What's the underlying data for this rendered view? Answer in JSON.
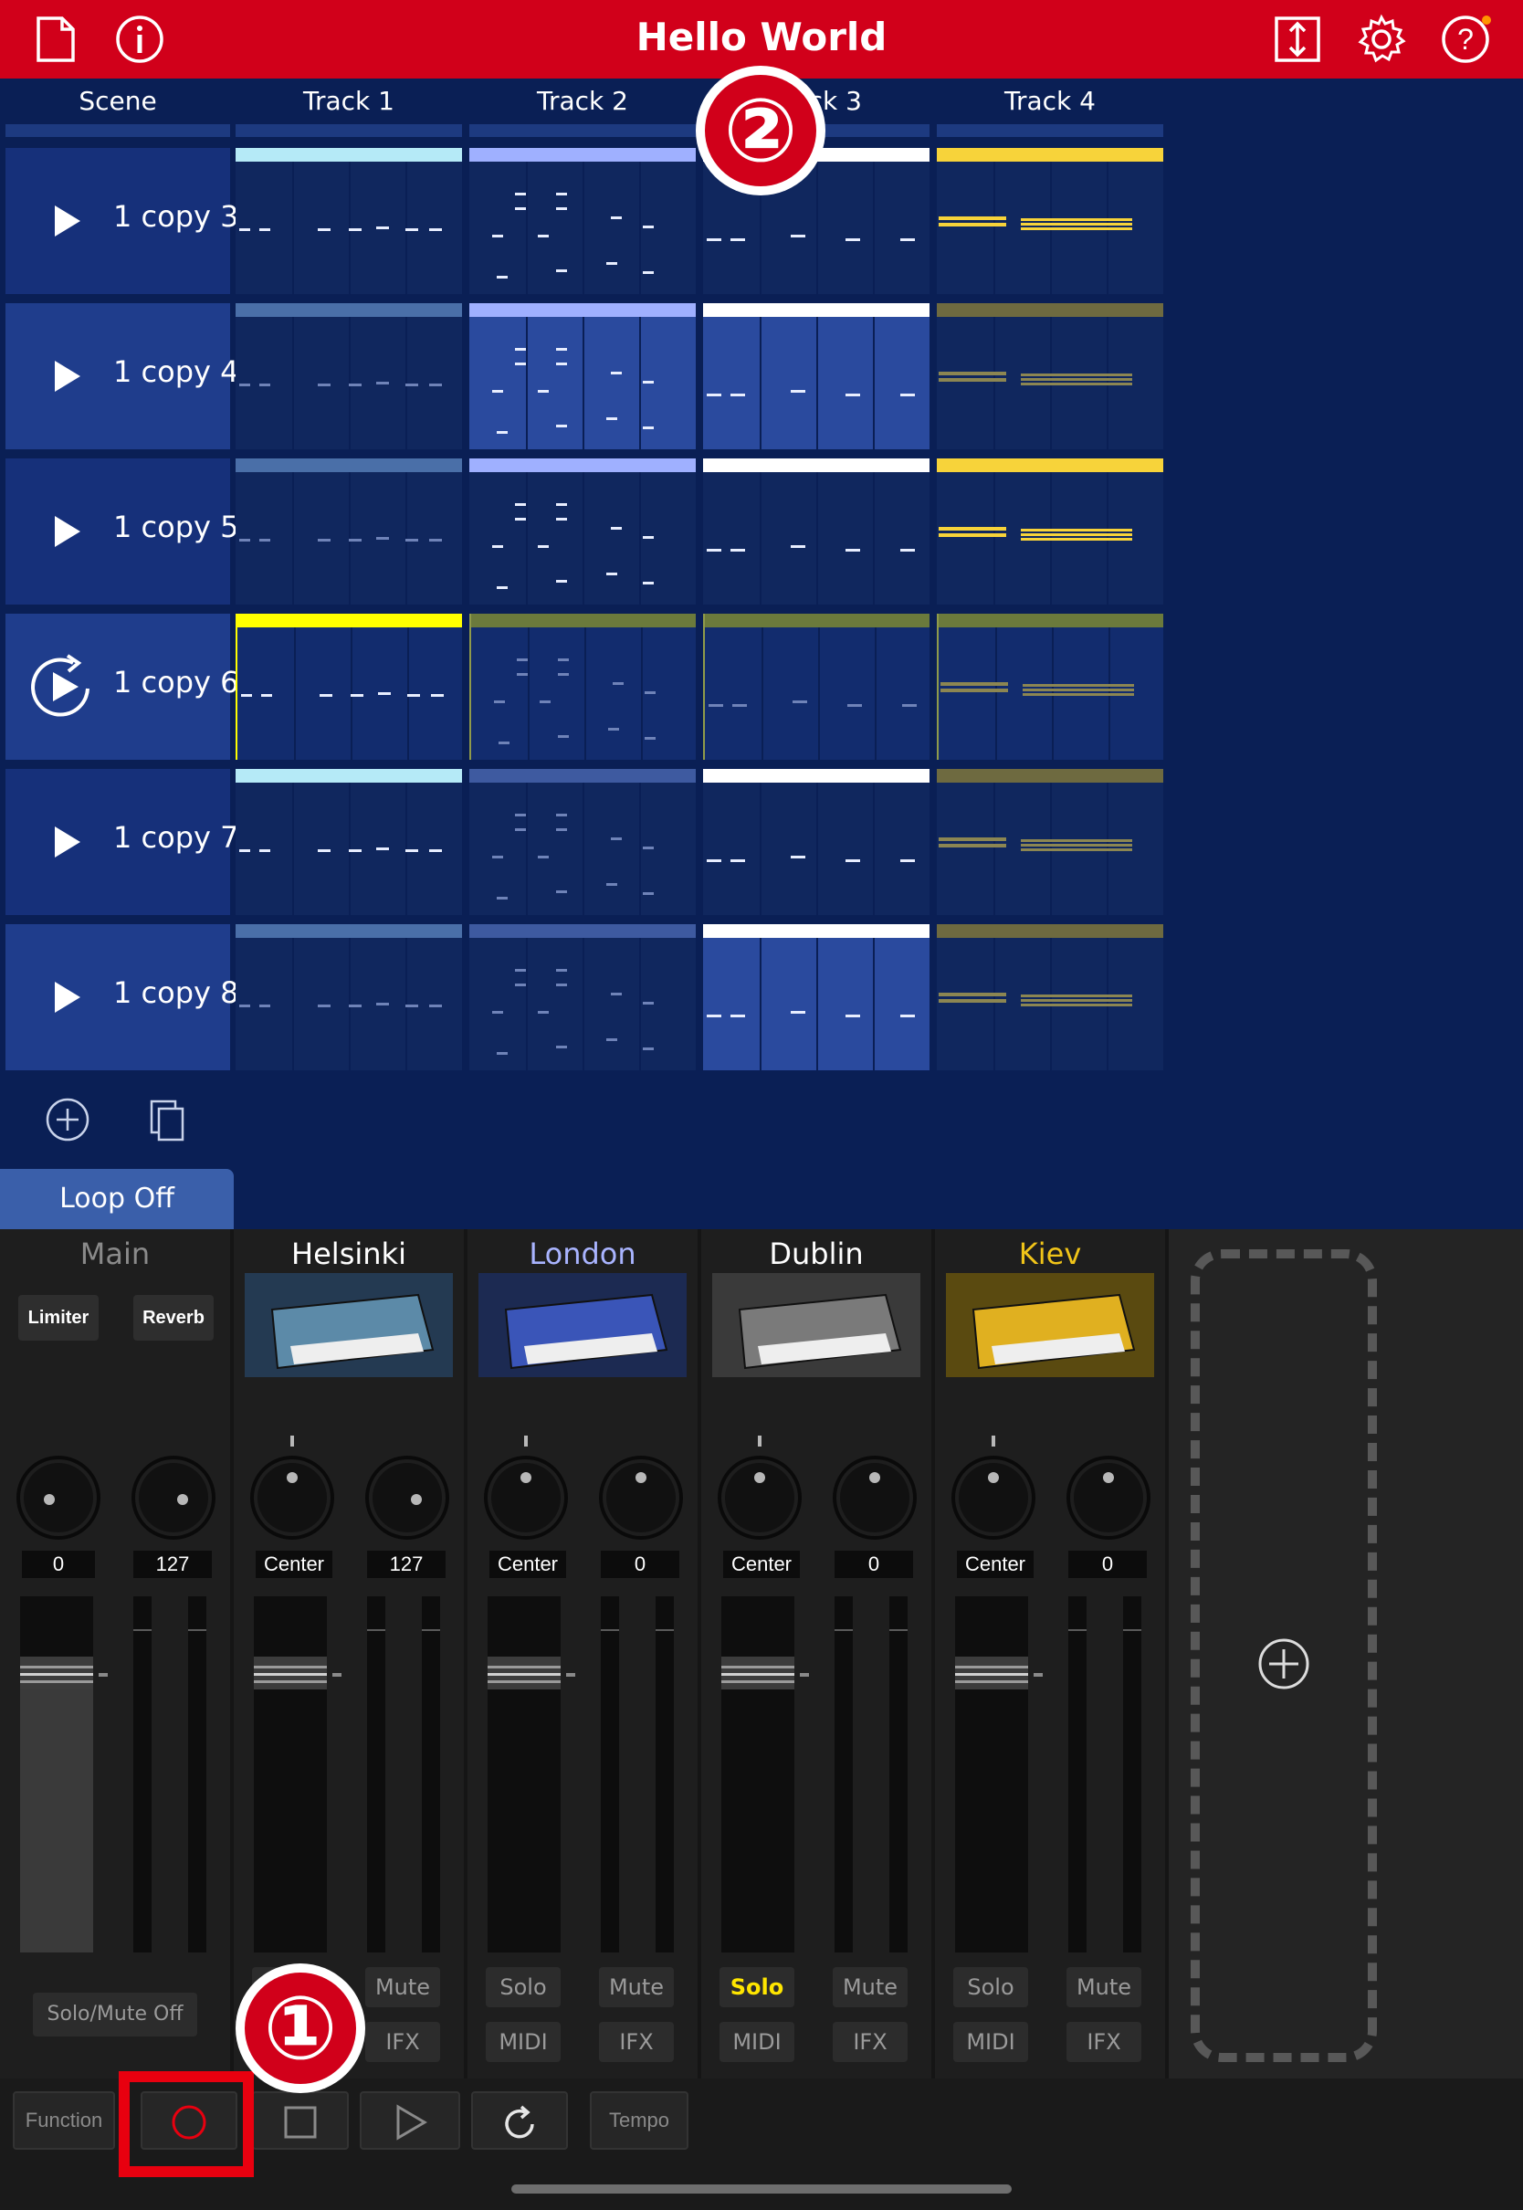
{
  "window": {
    "title": "Hello World"
  },
  "topbar_icons": [
    "new-document-icon",
    "info-icon",
    "import-export-icon",
    "settings-gear-icon",
    "help-icon"
  ],
  "colors": {
    "brand_red": "#d1001a",
    "session_bg": "#0a1f55"
  },
  "session": {
    "headers": [
      "Scene",
      "Track 1",
      "Track 2",
      "Track 3",
      "Track 4"
    ],
    "scenes": [
      {
        "name": "1 copy 3",
        "state": "stopped"
      },
      {
        "name": "1 copy 4",
        "state": "stopped"
      },
      {
        "name": "1 copy 5",
        "state": "stopped"
      },
      {
        "name": "1 copy 6",
        "state": "playing-loop"
      },
      {
        "name": "1 copy 7",
        "state": "stopped"
      },
      {
        "name": "1 copy 8",
        "state": "stopped"
      }
    ],
    "clip_colors": [
      [
        "#b5eaf7",
        "#9fb0ff",
        "#ffffff",
        "#f7d33a"
      ],
      [
        "#4a6fa8",
        "#9fb0ff",
        "#ffffff",
        "#6e6a40"
      ],
      [
        "#4a6fa8",
        "#9fb0ff",
        "#ffffff",
        "#f7d33a"
      ],
      [
        "#ffff00",
        "#6b7a3c",
        "#6b7a3c",
        "#6b7a3c"
      ],
      [
        "#b5eaf7",
        "#3e5aa0",
        "#ffffff",
        "#6e6a40"
      ],
      [
        "#4a6fa8",
        "#3e5aa0",
        "#ffffff",
        "#6e6a40"
      ]
    ],
    "add_scene_icon": "add-circle-icon",
    "duplicate_scene_icon": "copy-icon",
    "loop_label": "Loop Off"
  },
  "mixer": {
    "strips": [
      {
        "name": "Main",
        "name_color": "#8a8a8a",
        "pan": "0",
        "vol": "127"
      },
      {
        "name": "Helsinki",
        "name_color": "#ffffff",
        "pan": "Center",
        "vol": "127"
      },
      {
        "name": "London",
        "name_color": "#a9b4ff",
        "pan": "Center",
        "vol": "0"
      },
      {
        "name": "Dublin",
        "name_color": "#ffffff",
        "pan": "Center",
        "vol": "0"
      },
      {
        "name": "Kiev",
        "name_color": "#f0c419",
        "pan": "Center",
        "vol": "0"
      }
    ],
    "main_fx": {
      "limiter": "Limiter",
      "reverb": "Reverb"
    },
    "solo_mute_off": "Solo/Mute Off",
    "labels": {
      "solo": "Solo",
      "mute": "Mute",
      "midi": "MIDI",
      "ifx": "IFX"
    },
    "solo_active_color": "#ffe600",
    "add_track_icon": "add-circle-icon"
  },
  "transport": {
    "function": "Function",
    "tempo": "Tempo",
    "icons": [
      "record-icon",
      "stop-icon",
      "play-icon",
      "loop-icon"
    ]
  },
  "annotations": {
    "step1": "①",
    "step2": "②"
  }
}
